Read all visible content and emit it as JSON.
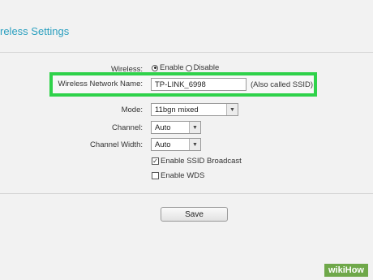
{
  "page": {
    "title": "reless Settings"
  },
  "wireless": {
    "label": "Wireless:",
    "enable_label": "Enable",
    "disable_label": "Disable",
    "selected": "Enable"
  },
  "network_name": {
    "label": "Wireless Network Name:",
    "value": "TP-LINK_6998",
    "note": "(Also called SSID)",
    "highlight_color": "#2fd24a"
  },
  "mode": {
    "label": "Mode:",
    "value": "11bgn mixed"
  },
  "channel": {
    "label": "Channel:",
    "value": "Auto"
  },
  "channel_width": {
    "label": "Channel Width:",
    "value": "Auto"
  },
  "ssid_broadcast": {
    "label": "Enable SSID Broadcast",
    "checked": true
  },
  "wds": {
    "label": "Enable WDS",
    "checked": false
  },
  "save_button": {
    "label": "Save"
  },
  "watermark": {
    "wiki": "wiki",
    "how": "How"
  },
  "colors": {
    "title": "#2a9fbf",
    "highlight": "#2fd24a"
  }
}
